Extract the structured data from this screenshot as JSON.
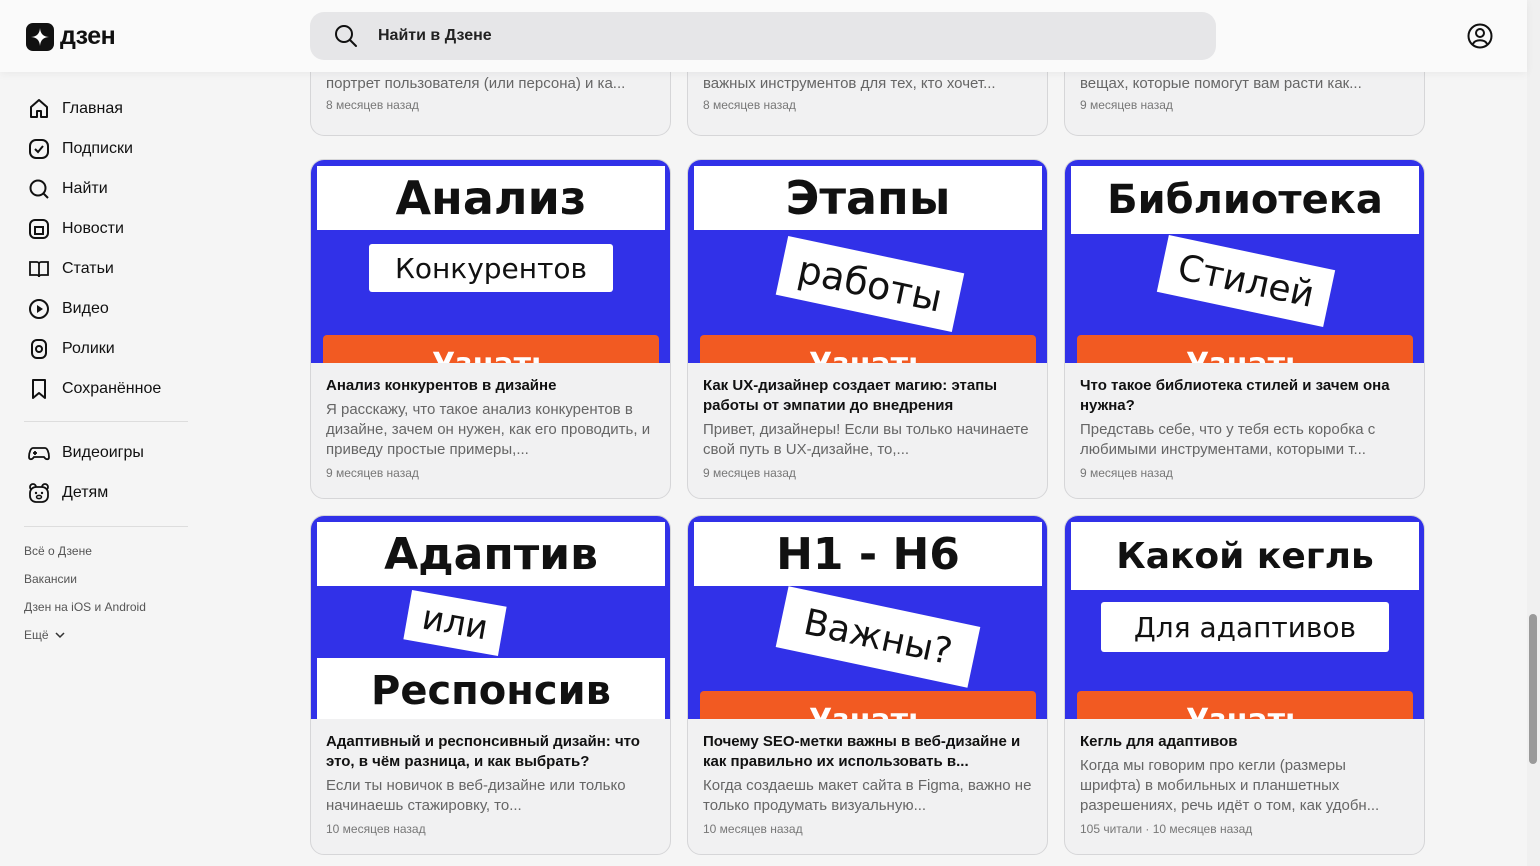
{
  "header": {
    "logo_text": "дзен",
    "search_placeholder": "Найти в Дзене"
  },
  "sidebar": {
    "items": [
      {
        "label": "Главная",
        "icon": "home-icon"
      },
      {
        "label": "Подписки",
        "icon": "subscriptions-icon"
      },
      {
        "label": "Найти",
        "icon": "search-icon"
      },
      {
        "label": "Новости",
        "icon": "news-icon"
      },
      {
        "label": "Статьи",
        "icon": "articles-icon"
      },
      {
        "label": "Видео",
        "icon": "video-icon"
      },
      {
        "label": "Ролики",
        "icon": "shorts-icon"
      },
      {
        "label": "Сохранённое",
        "icon": "bookmark-icon"
      },
      {
        "label": "Видеоигры",
        "icon": "gamepad-icon"
      },
      {
        "label": "Детям",
        "icon": "kids-icon"
      }
    ],
    "footer": {
      "about": "Всё о Дзене",
      "jobs": "Вакансии",
      "apps": "Дзен на iOS и Android",
      "more": "Ещё"
    }
  },
  "top_cards": [
    {
      "desc": "портрет пользователя (или персона) и ка...",
      "meta": "8 месяцев назад"
    },
    {
      "desc": "важных инструментов для тех, кто хочет...",
      "meta": "8 месяцев назад"
    },
    {
      "desc": "вещах, которые помогут вам расти как...",
      "meta": "9 месяцев назад"
    }
  ],
  "cards": [
    {
      "thumb": {
        "line1": "Анализ",
        "line2": "Конкурентов",
        "button": "Узнать"
      },
      "title": "Анализ конкурентов в дизайне",
      "desc": "Я расскажу, что такое анализ конкурентов в дизайне, зачем он нужен, как его проводить, и приведу простые примеры,...",
      "meta": "9 месяцев назад"
    },
    {
      "thumb": {
        "line1": "Этапы",
        "line2": "работы",
        "button": "Узнать"
      },
      "title": "Как UX-дизайнер создает магию: этапы работы от эмпатии до внедрения",
      "desc": "Привет, дизайнеры! Если вы только начинаете свой путь в UX-дизайне, то,...",
      "meta": "9 месяцев назад"
    },
    {
      "thumb": {
        "line1": "Библиотека",
        "line2": "Стилей",
        "button": "Узнать"
      },
      "title": "Что такое библиотека стилей и зачем она нужна?",
      "desc": "Представь себе, что у тебя есть коробка с любимыми инструментами, которыми т...",
      "meta": "9 месяцев назад"
    },
    {
      "thumb": {
        "line1": "Адаптив",
        "line2": "или",
        "line3": "Респонсив"
      },
      "title": "Адаптивный и респонсивный дизайн: что это, в чём разница, и как выбрать?",
      "desc": "Если ты новичок в веб-дизайне или только начинаешь стажировку, то...",
      "meta": "10 месяцев назад"
    },
    {
      "thumb": {
        "line1": "H1 - H6",
        "line2": "Важны?",
        "button": "Узнать"
      },
      "title": "Почему SEO-метки важны в веб-дизайне и как правильно их использовать в...",
      "desc": "Когда создаешь макет сайта в Figma, важно не только продумать визуальную...",
      "meta": "10 месяцев назад"
    },
    {
      "thumb": {
        "line1": "Какой кегль",
        "line2": "Для адаптивов",
        "button": "Узнать"
      },
      "title": "Кегль для адаптивов",
      "desc": "Когда мы говорим про кегли (размеры шрифта) в мобильных и планшетных разрешениях, речь идёт о том, как удобн...",
      "meta": "105 читали · 10 месяцев назад"
    }
  ],
  "colors": {
    "thumb_blue": "#3131e8",
    "thumb_orange": "#f25a22"
  }
}
